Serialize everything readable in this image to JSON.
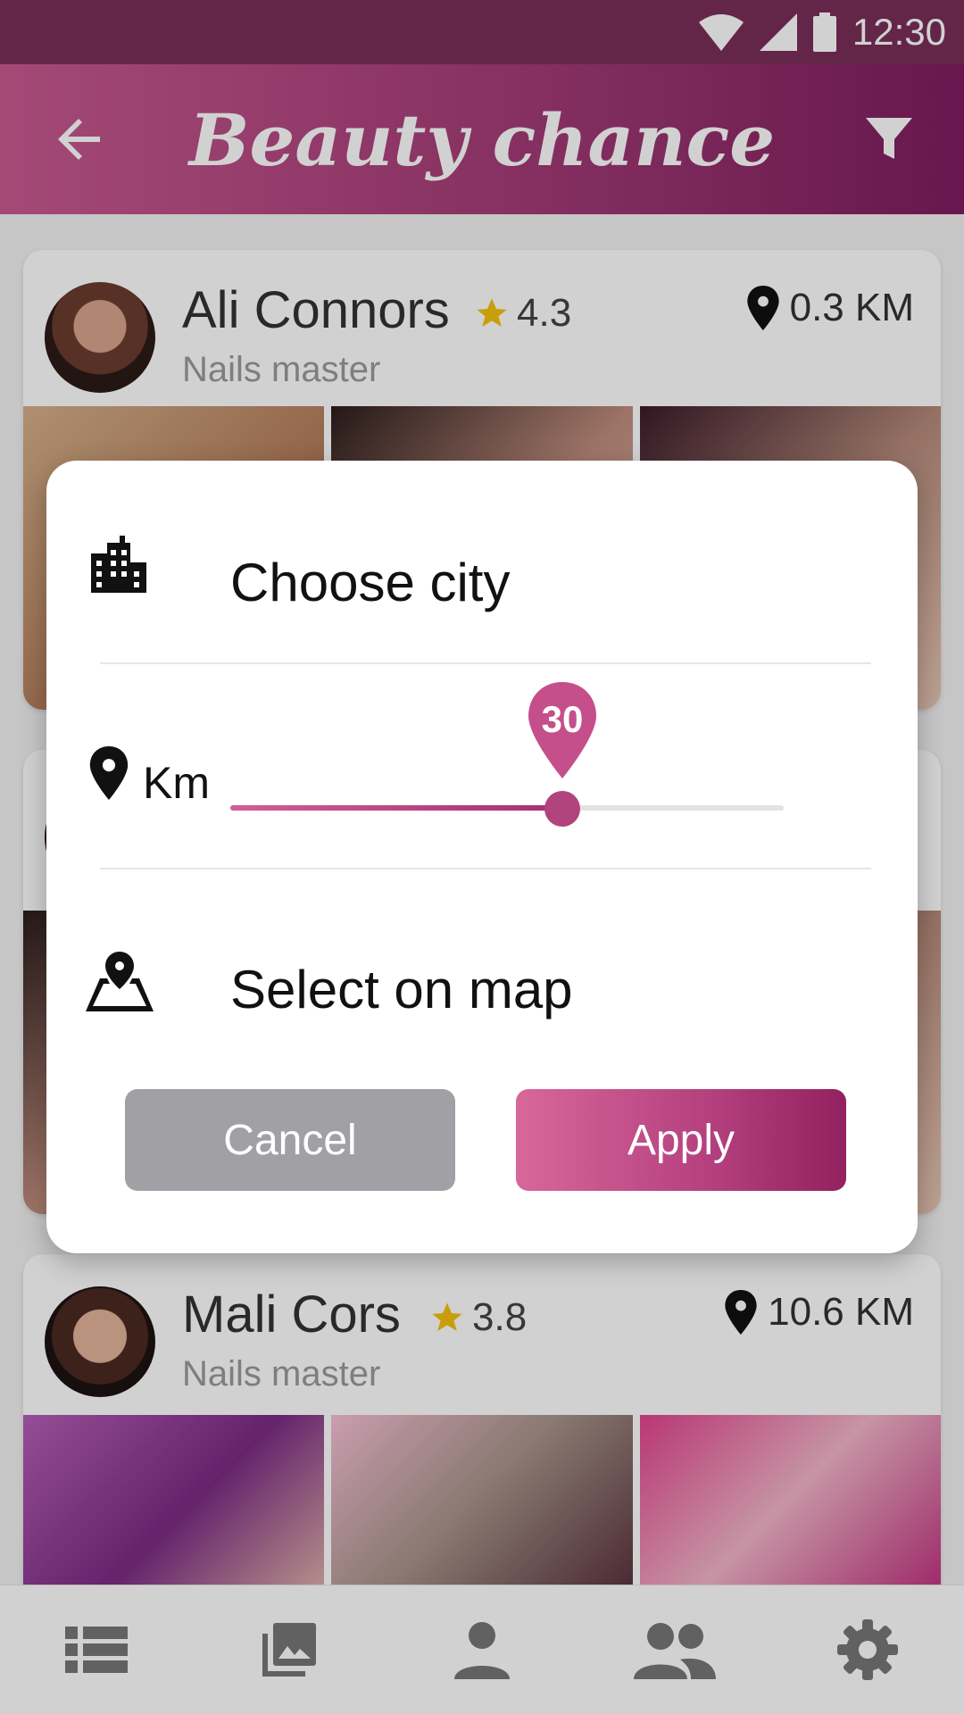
{
  "status_bar": {
    "time": "12:30"
  },
  "app_bar": {
    "title": "Beauty chance"
  },
  "cards": [
    {
      "name": "Ali Connors",
      "rating": "4.3",
      "subtitle": "Nails master",
      "distance": "0.3 KM"
    },
    {
      "name": "",
      "rating": "",
      "subtitle": "",
      "distance": ""
    },
    {
      "name": "Mali Cors",
      "rating": "3.8",
      "subtitle": "Nails master",
      "distance": "10.6 KM"
    }
  ],
  "dialog": {
    "city_label": "Choose city",
    "km_label": "Km",
    "slider": {
      "value": 30,
      "min": 0,
      "max": 50,
      "value_label": "30"
    },
    "map_label": "Select on map",
    "cancel_label": "Cancel",
    "apply_label": "Apply"
  },
  "bottom_nav": {
    "items": [
      "list-icon",
      "gallery-icon",
      "person-icon",
      "group-icon",
      "settings-icon"
    ]
  },
  "colors": {
    "primary": "#a33b77",
    "primary_dark": "#7a2f58",
    "accent": "#d8679a",
    "cancel": "#a1a1a5"
  }
}
